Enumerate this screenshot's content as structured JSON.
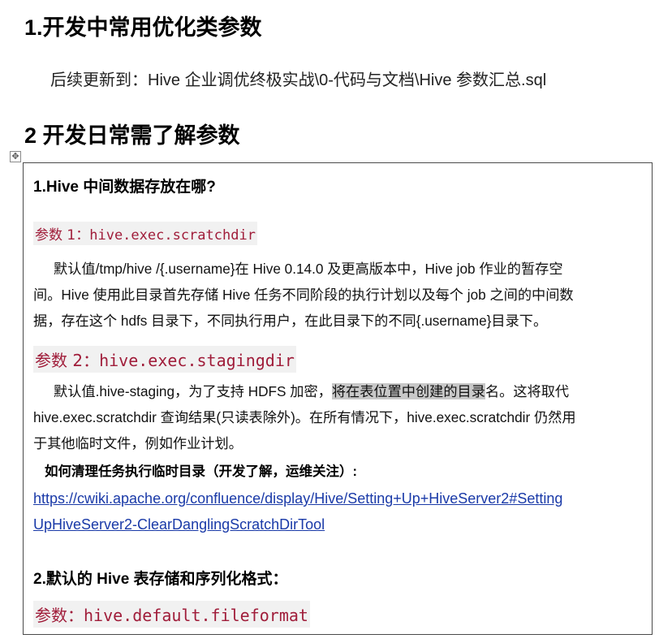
{
  "heading1": "1.开发中常用优化类参数",
  "update_note": "后续更新到：Hive 企业调优终极实战\\0-代码与文档\\Hive 参数汇总.sql",
  "heading2": "2 开发日常需了解参数",
  "move_handle_glyph": "✥",
  "box": {
    "q1_title": "1.Hive 中间数据存放在哪?",
    "param1_label": "参数 1：",
    "param1_value": "hive.exec.scratchdir",
    "param1_desc": [
      "默认值/tmp/hive /{.username}在  Hive 0.14.0  及更高版本中，Hive job 作业的暂存空",
      "间。Hive  使用此目录首先存储 Hive 任务不同阶段的执行计划以及每个 job 之间的中间数",
      "据，存在这个 hdfs 目录下，不同执行用户，在此目录下的不同{.username}目录下。"
    ],
    "param2_label": "参数 2：",
    "param2_value": "hive.exec.stagingdir",
    "param2_desc": {
      "line1_before": "默认值.hive-staging，为了支持 HDFS 加密，",
      "line1_highlight": "将在表位置中创建的目录",
      "line1_after": "名。这将取代",
      "line2": "hive.exec.scratchdir 查询结果(只读表除外)。在所有情况下，hive.exec.scratchdir 仍然用",
      "line3": "于其他临时文件，例如作业计划。"
    },
    "howto_title": "如何清理任务执行临时目录（开发了解，运维关注）:",
    "link_lines": [
      "https://cwiki.apache.org/confluence/display/Hive/Setting+Up+HiveServer2#Setting",
      "UpHiveServer2-ClearDanglingScratchDirTool"
    ],
    "q2_title": "2.默认的 Hive 表存储和序列化格式：",
    "param3_label": "参数：",
    "param3_value": "hive.default.fileformat"
  }
}
